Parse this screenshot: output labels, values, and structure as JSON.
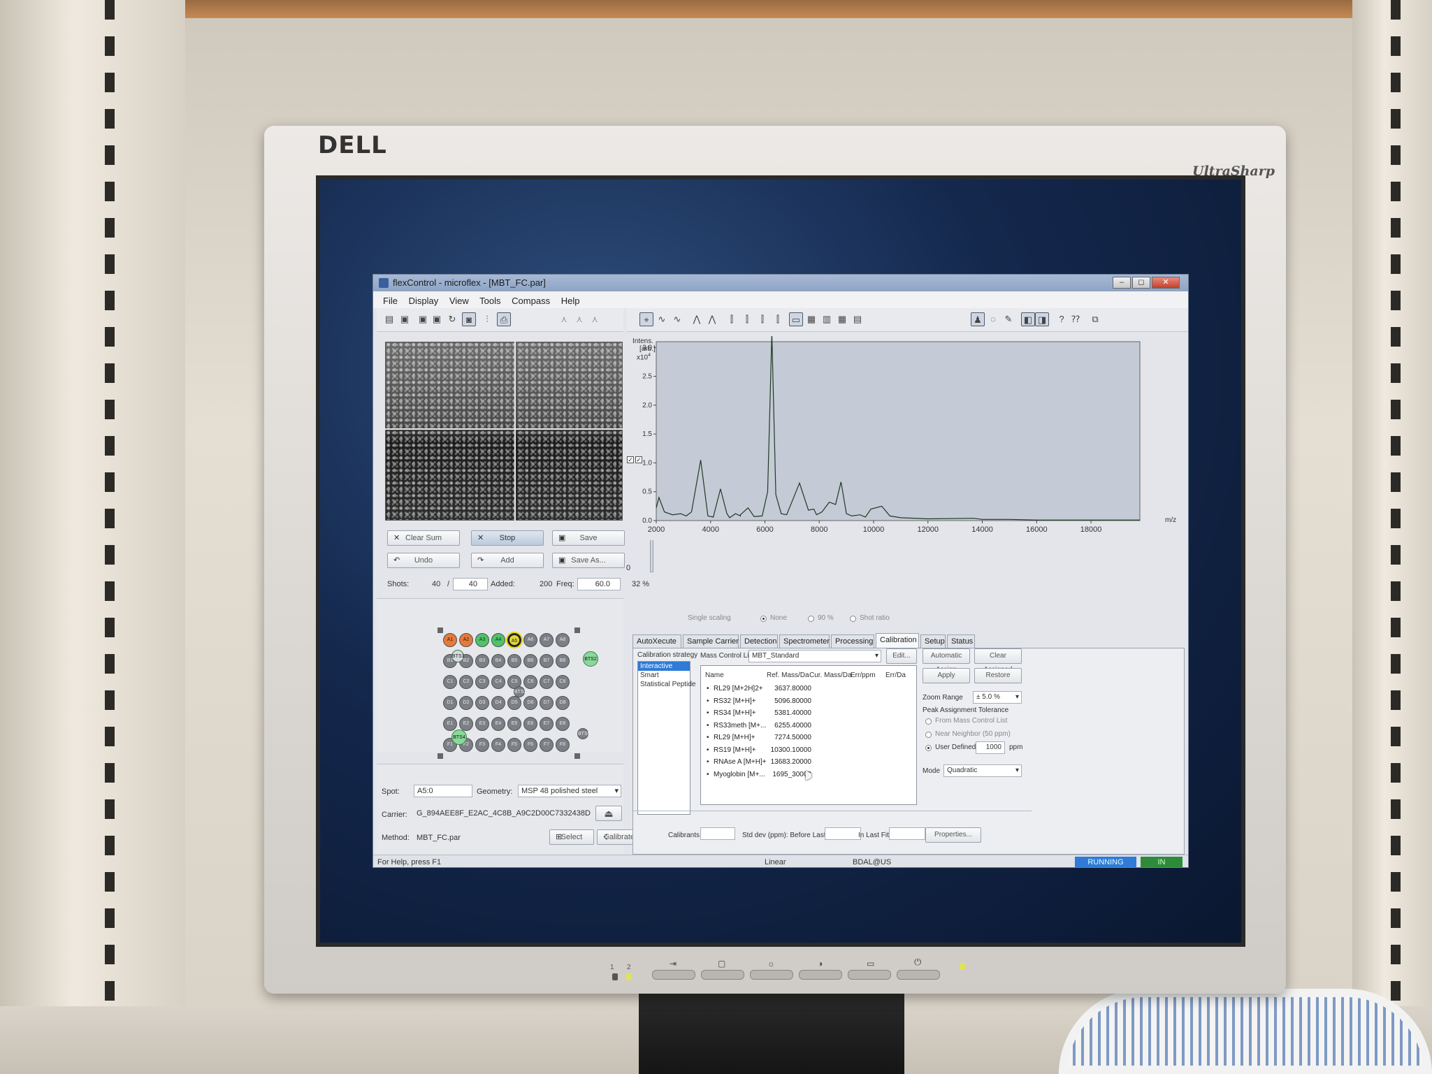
{
  "monitor": {
    "brand": "DELL",
    "model": "UltraSharp",
    "front_buttons": [
      "⇥",
      "▢",
      "☼",
      "◑",
      "▭",
      "⏻"
    ],
    "led_labels": [
      "1",
      "2"
    ]
  },
  "window": {
    "title": "flexControl - microflex - [MBT_FC.par]",
    "controls": [
      "–",
      "◻",
      "✕"
    ],
    "menu": [
      "File",
      "Display",
      "View",
      "Tools",
      "Compass",
      "Help"
    ]
  },
  "camera": {
    "scale_top": "100",
    "scale_bottom": "0",
    "buttons": {
      "clear_sum": "Clear Sum",
      "stop": "Stop",
      "save": "Save",
      "undo": "Undo",
      "add": "Add",
      "save_as": "Save As..."
    },
    "shots_label": "Shots:",
    "shots_value": "40",
    "shots_sep": "/",
    "shots_total": "40",
    "added_label": "Added:",
    "added_value": "200",
    "freq_label": "Freq:",
    "freq_value": "60.0",
    "percent": "32 %"
  },
  "plate": {
    "rows": [
      [
        "A1",
        "A2",
        "A3",
        "A4",
        "A5",
        "A6",
        "A7",
        "A8"
      ],
      [
        "B1",
        "B2",
        "B3",
        "B4",
        "B5",
        "B6",
        "B7",
        "B8"
      ],
      [
        "C1",
        "C2",
        "C3",
        "C4",
        "C5",
        "C6",
        "C7",
        "C8"
      ],
      [
        "D1",
        "D2",
        "D3",
        "D4",
        "D5",
        "D6",
        "D7",
        "D8"
      ],
      [
        "E1",
        "E2",
        "E3",
        "E4",
        "E5",
        "E6",
        "E7",
        "E8"
      ],
      [
        "F1",
        "F2",
        "F3",
        "F4",
        "F5",
        "F6",
        "F7",
        "F8"
      ]
    ],
    "orange_wells": [
      "A1",
      "A2"
    ],
    "green_wells": [
      "A3",
      "A4"
    ],
    "selected_well": "A5",
    "bts_labels": [
      "BTS1",
      "BTS2",
      "BTS3",
      "BTS4",
      "BTS5"
    ],
    "bts_colors": {
      "green": "#88d99a",
      "grey": "#7c7f85"
    }
  },
  "info": {
    "spot_label": "Spot:",
    "spot_value": "A5:0",
    "geometry_label": "Geometry:",
    "geometry_value": "MSP 48 polished steel",
    "carrier_label": "Carrier:",
    "carrier_value": "G_894AEE8F_E2AC_4C8B_A9C2D00C7332438D",
    "method_label": "Method:",
    "method_value": "MBT_FC.par",
    "select_button": "Select",
    "calibrate_button": "Calibrate"
  },
  "spectrum": {
    "y_title": "Intens.",
    "y_unit": "[arb.]",
    "y_mult": "x10",
    "y_exp": "4",
    "x_unit": "m/z",
    "scaling": {
      "label": "Single scaling",
      "options": [
        "None",
        "90 %",
        "Shot ratio"
      ],
      "selected": "None"
    }
  },
  "chart_data": {
    "type": "line",
    "title": "",
    "xlabel": "m/z",
    "ylabel": "Intens. [arb.] x10^4",
    "xlim": [
      2000,
      19800
    ],
    "ylim": [
      0,
      3.1
    ],
    "x_ticks": [
      "2000",
      "4000",
      "6000",
      "8000",
      "10000",
      "12000",
      "14000",
      "16000",
      "18000"
    ],
    "y_ticks": [
      "0.0",
      "0.5",
      "1.0",
      "1.5",
      "2.0",
      "2.5",
      "3.0"
    ],
    "series": [
      {
        "x": [
          2000,
          2100,
          2300,
          2600,
          2900,
          3100,
          3300,
          3637,
          3900,
          4100,
          4365,
          4600,
          4700,
          4920,
          5100,
          5096,
          5381,
          5600,
          5900,
          6100,
          6255,
          6400,
          6600,
          6800,
          7274,
          7600,
          7800,
          7900,
          8100,
          8370,
          8600,
          8800,
          9000,
          9200,
          9500,
          9700,
          9900,
          10300,
          10600,
          11000,
          12000,
          13683,
          14000,
          15000,
          16000,
          17000,
          18000,
          19000,
          19800
        ],
        "y": [
          0.22,
          0.4,
          0.15,
          0.1,
          0.12,
          0.08,
          0.15,
          1.05,
          0.08,
          0.06,
          0.55,
          0.12,
          0.05,
          0.12,
          0.08,
          0.1,
          0.22,
          0.07,
          0.08,
          0.5,
          3.25,
          0.45,
          0.12,
          0.1,
          0.65,
          0.18,
          0.2,
          0.1,
          0.15,
          0.32,
          0.28,
          0.67,
          0.12,
          0.08,
          0.1,
          0.06,
          0.2,
          0.25,
          0.08,
          0.05,
          0.03,
          0.04,
          0.02,
          0.02,
          0.01,
          0.01,
          0.01,
          0.01,
          0.01
        ]
      }
    ],
    "grid": false,
    "legend": "none"
  },
  "tabs": [
    "AutoXecute",
    "Sample Carrier",
    "Detection",
    "Spectrometer",
    "Processing",
    "Calibration",
    "Setup",
    "Status"
  ],
  "active_tab": "Calibration",
  "calibration": {
    "strategy_label": "Calibration strategy",
    "strategies": [
      "Interactive",
      "Smart",
      "Statistical Peptide"
    ],
    "mcl_label": "Mass Control List",
    "mcl_value": "MBT_Standard",
    "edit_button": "Edit...",
    "columns": [
      "Name",
      "Ref. Mass/Da",
      "Cur. Mass/Da",
      "Err/ppm",
      "Err/Da"
    ],
    "rows": [
      {
        "name": "RL29 [M+2H]2+",
        "ref": "3637.80000"
      },
      {
        "name": "RS32 [M+H]+",
        "ref": "5096.80000"
      },
      {
        "name": "RS34 [M+H]+",
        "ref": "5381.40000"
      },
      {
        "name": "RS33meth [M+...",
        "ref": "6255.40000"
      },
      {
        "name": "RL29 [M+H]+",
        "ref": "7274.50000"
      },
      {
        "name": "RS19 [M+H]+",
        "ref": "10300.10000"
      },
      {
        "name": "RNAse A [M+H]+",
        "ref": "13683.20000"
      },
      {
        "name": "Myoglobin [M+...",
        "ref": "1695_30000"
      }
    ],
    "auto_assign": "Automatic Assign",
    "clear_assigned": "Clear Assigned",
    "apply": "Apply",
    "restore": "Restore",
    "zoom_label": "Zoom Range",
    "zoom_value": "± 5.0 %",
    "tolerance_label": "Peak Assignment Tolerance",
    "tolerance_options": [
      "From Mass Control List",
      "Near Neighbor (50 ppm)",
      "User Defined"
    ],
    "tolerance_selected": "User Defined",
    "user_value": "1000",
    "ppm": "ppm",
    "mode_label": "Mode",
    "mode_value": "Quadratic",
    "calibrants_label": "Calibrants",
    "std_label": "Std dev (ppm): Before Last Fit",
    "last_fit_label": "In Last Fit",
    "properties_button": "Properties..."
  },
  "status": {
    "help": "For Help, press F1",
    "mode": "Linear",
    "user": "BDAL@US",
    "running": "RUNNING",
    "in": "IN",
    "running_color": "#2f7bd6",
    "in_color": "#2e8b3a"
  }
}
